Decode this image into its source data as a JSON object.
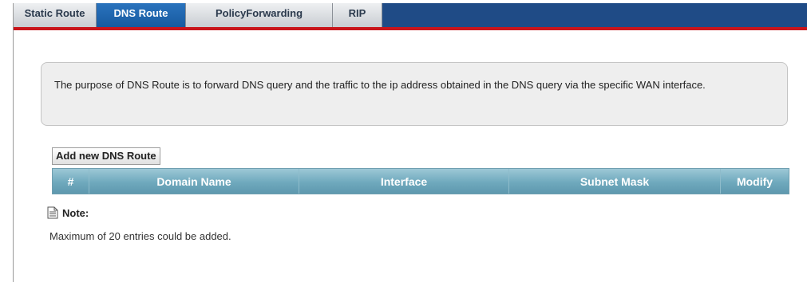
{
  "tabs": [
    {
      "label": "Static Route",
      "active": false
    },
    {
      "label": "DNS Route",
      "active": true
    },
    {
      "label": "PolicyForwarding",
      "active": false
    },
    {
      "label": "RIP",
      "active": false
    }
  ],
  "info": {
    "text": "The purpose of DNS Route is to forward DNS query and the traffic to the ip address obtained in the DNS query via the specific WAN interface."
  },
  "actions": {
    "add_label": "Add new DNS Route"
  },
  "table": {
    "columns": [
      "#",
      "Domain Name",
      "Interface",
      "Subnet Mask",
      "Modify"
    ],
    "rows": []
  },
  "note": {
    "label": "Note:",
    "text": "Maximum of 20 entries could be added."
  },
  "colors": {
    "tabbar_bg": "#1f4b86",
    "tabbar_underline": "#c9151b",
    "active_tab": "#175aa0",
    "table_header": "#6fa9bd"
  },
  "icons": {
    "note": "document-icon"
  }
}
